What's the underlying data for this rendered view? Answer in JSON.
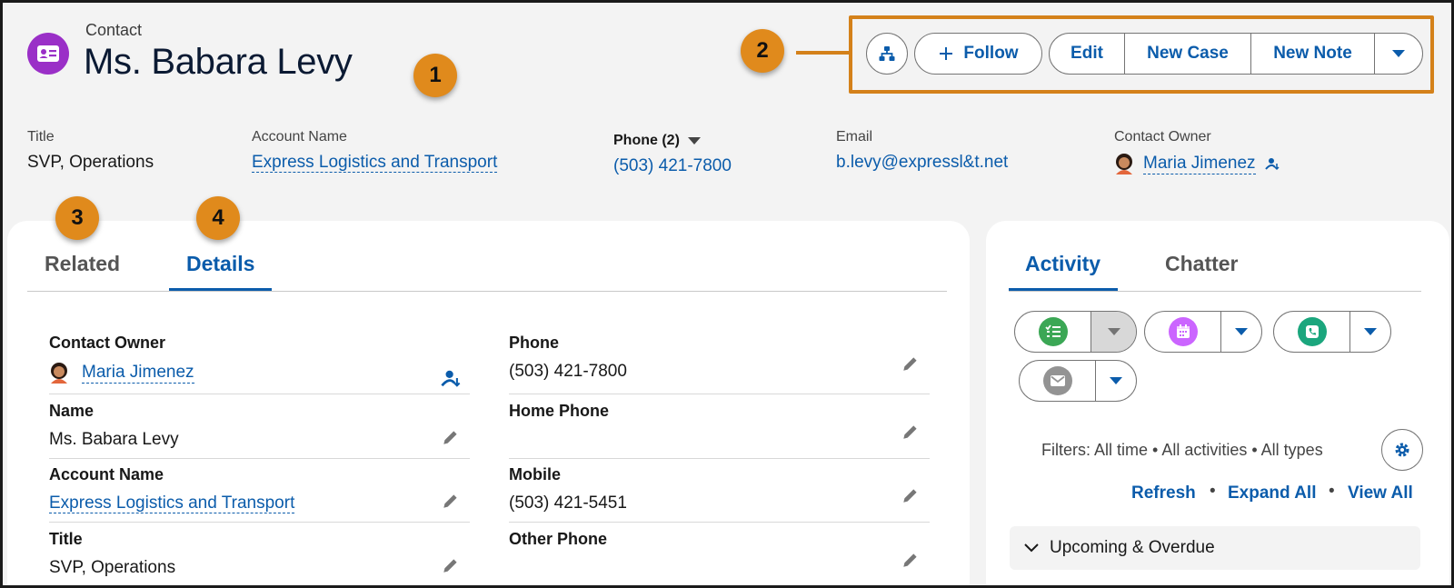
{
  "header": {
    "object_label": "Contact",
    "record_name": "Ms. Babara Levy",
    "follow_label": "Follow",
    "edit_label": "Edit",
    "new_case_label": "New Case",
    "new_note_label": "New Note"
  },
  "callouts": [
    "1",
    "2",
    "3",
    "4"
  ],
  "highlights": {
    "title": {
      "label": "Title",
      "value": "SVP, Operations"
    },
    "account": {
      "label": "Account Name",
      "value": "Express Logistics and Transport"
    },
    "phone": {
      "label": "Phone (2)",
      "value": "(503) 421-7800"
    },
    "email": {
      "label": "Email",
      "value": "b.levy@expressl&t.net"
    },
    "owner": {
      "label": "Contact Owner",
      "value": "Maria Jimenez"
    }
  },
  "left_tabs": [
    {
      "label": "Related",
      "active": false
    },
    {
      "label": "Details",
      "active": true
    }
  ],
  "details": {
    "contact_owner": {
      "label": "Contact Owner",
      "value": "Maria Jimenez"
    },
    "name": {
      "label": "Name",
      "value": "Ms. Babara Levy"
    },
    "account_name": {
      "label": "Account Name",
      "value": "Express Logistics and Transport"
    },
    "title": {
      "label": "Title",
      "value": "SVP, Operations"
    },
    "phone": {
      "label": "Phone",
      "value": "(503) 421-7800"
    },
    "home_phone": {
      "label": "Home Phone",
      "value": ""
    },
    "mobile": {
      "label": "Mobile",
      "value": "(503) 421-5451"
    },
    "other_phone": {
      "label": "Other Phone",
      "value": ""
    }
  },
  "right_tabs": [
    {
      "label": "Activity",
      "active": true
    },
    {
      "label": "Chatter",
      "active": false
    }
  ],
  "activity": {
    "buttons": [
      {
        "icon": "task-icon",
        "color": "#3ba755"
      },
      {
        "icon": "event-icon",
        "color": "#cb65ff"
      },
      {
        "icon": "call-icon",
        "color": "#1ba67d"
      },
      {
        "icon": "email-icon",
        "color": "#939393"
      }
    ],
    "filters_text": "Filters: All time • All activities • All types",
    "refresh_label": "Refresh",
    "expand_all_label": "Expand All",
    "view_all_label": "View All",
    "separator": "•",
    "upcoming_label": "Upcoming & Overdue"
  },
  "colors": {
    "accent": "#0b5cab",
    "callout": "#e08a1c",
    "contact_icon": "#9a2fc7"
  }
}
